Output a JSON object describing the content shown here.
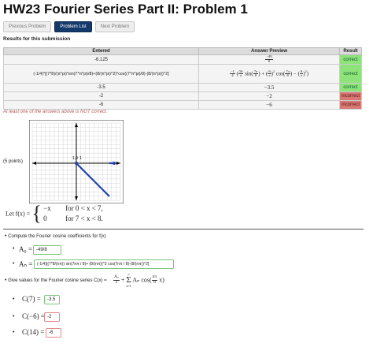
{
  "page": {
    "title": "HW23 Fourier Series Part II: Problem 1"
  },
  "nav": [
    {
      "label": "Previous Problem",
      "active": false
    },
    {
      "label": "Problem List",
      "active": true
    },
    {
      "label": "Next Problem",
      "active": false
    }
  ],
  "results": {
    "heading": "Results for this submission",
    "headers": [
      "Entered",
      "Answer Preview",
      "Result"
    ],
    "rows": [
      {
        "entered": "-6.125",
        "preview": "−49/8",
        "result": "correct"
      },
      {
        "entered": "(-1/4)*[(7*8)/(π*pi)*sin(7*π*pi)/8)+(8/(π*pi)^2)*cos((7*π*pi)/8)-(8/(π*pi))^2]",
        "preview": "−1/4 (56/π sin(7π/8) + (8/π)² cos(7π/8) − (8/π)²)",
        "result": "correct"
      },
      {
        "entered": "-3.5",
        "preview": "−3.5",
        "result": "correct"
      },
      {
        "entered": "-2",
        "preview": "−2",
        "result": "incorrect"
      },
      {
        "entered": "-6",
        "preview": "−6",
        "result": "incorrect"
      }
    ],
    "warning": "At least one of the answers above is NOT correct."
  },
  "problem": {
    "points": "(5 points)",
    "graph": {
      "tick_labels": [
        "1,0",
        "1"
      ]
    },
    "definition_prefix": "Let f(x) =",
    "cases": [
      {
        "expr": "−x",
        "cond": "for 0 < x < 7,"
      },
      {
        "expr": "0",
        "cond": "for 7 < x < 8."
      }
    ],
    "cosine_coeffs_prompt": "Compute the Fourier cosine coefficients for f(x)",
    "a0_label": "A₀ =",
    "a0_value": "-49/8",
    "an_label": "Aₙ =",
    "an_value": "(-1/4)[(7*8/(nπ)) sin(7nπ / 8)+ (8/(nπ))^2 cos(7nπ / 8)-(8/(nπ))^2]",
    "series_prompt": "Give values for the Fourier cosine series C(x) =",
    "series_formula": "A₀/2 + Σ Aₙ cos(nπx/8)",
    "values": [
      {
        "label": "C(7) =",
        "value": "-3.5",
        "status": "correct"
      },
      {
        "label": "C(−6) =",
        "value": "-2",
        "status": "incorrect"
      },
      {
        "label": "C(14) =",
        "value": "-6",
        "status": "incorrect"
      }
    ]
  }
}
